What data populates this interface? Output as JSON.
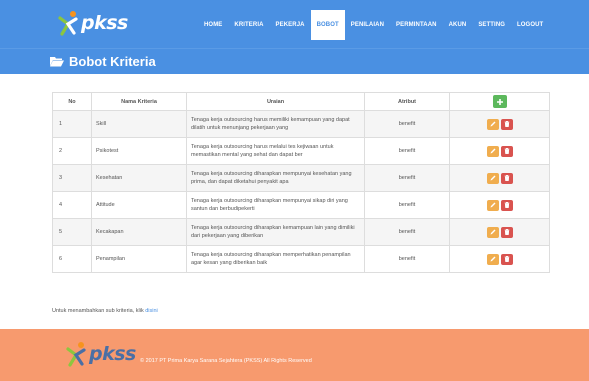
{
  "header": {
    "logo_text": "pkss",
    "nav": [
      "HOME",
      "KRITERIA",
      "PEKERJA",
      "BOBOT",
      "PENILAIAN",
      "PERMINTAAN",
      "AKUN",
      "SETTING",
      "LOGOUT"
    ],
    "active_nav": "BOBOT"
  },
  "page": {
    "title": "Bobot Kriteria"
  },
  "table": {
    "headers": {
      "no": "No",
      "nama": "Nama Kriteria",
      "uraian": "Uraian",
      "atribut": "Atribut"
    },
    "rows": [
      {
        "no": "1",
        "nama": "Skill",
        "uraian": "Tenaga kerja outsourcing harus memiliki kemampuan yang dapat dilatih untuk menunjang pekerjaan yang",
        "atribut": "benefit"
      },
      {
        "no": "2",
        "nama": "Psikotest",
        "uraian": "Tenaga kerja outsourcing harus melalui tes kejiwaan untuk memastikan mental yang sehat dan dapat ber",
        "atribut": "benefit"
      },
      {
        "no": "3",
        "nama": "Kesehatan",
        "uraian": "Tenaga kerja outsourcing diharapkan mempunyai kesehatan yang prima, dan dapat diketahui penyakit apa",
        "atribut": "benefit"
      },
      {
        "no": "4",
        "nama": "Attitude",
        "uraian": "Tenaga kerja outsourcing diharapkan mempunyai sikap diri yang santun dan berbudipekerti",
        "atribut": "benefit"
      },
      {
        "no": "5",
        "nama": "Kecakapan",
        "uraian": "Tenaga kerja outsourcing diharapkan kemampuan lain yang dimiliki dari pekerjaan yang diberikan",
        "atribut": "benefit"
      },
      {
        "no": "6",
        "nama": "Penampilan",
        "uraian": "Tenaga kerja outsourcing diharapkan memperhatikan penampilan agar kesan yang diberikan baik",
        "atribut": "benefit"
      }
    ]
  },
  "note": {
    "text": "Untuk menambahkan sub kriteria, klik",
    "link": "disini"
  },
  "footer": {
    "logo_text": "pkss",
    "copyright": "© 2017 PT Prima Karya Sarana Sejahtera (PKSS) All Rights Reserved"
  },
  "colors": {
    "primary": "#4a90e2",
    "footer": "#f79a6e",
    "add": "#5cb85c",
    "edit": "#f0ad4e",
    "delete": "#d9534f"
  },
  "icons": {
    "title": "folder-open-icon",
    "add": "plus-icon",
    "edit": "pencil-icon",
    "delete": "trash-icon"
  }
}
